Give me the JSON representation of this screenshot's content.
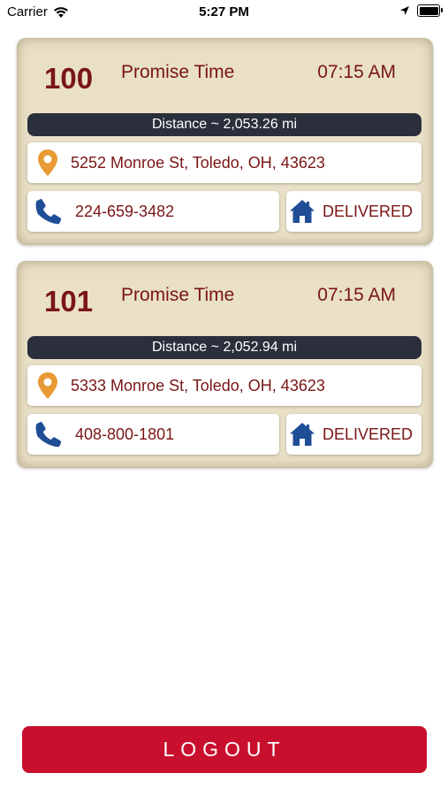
{
  "status_bar": {
    "carrier": "Carrier",
    "time": "5:27 PM",
    "icons": [
      "wifi-icon",
      "location-arrow-icon",
      "battery-icon"
    ]
  },
  "orders": [
    {
      "number": "100",
      "promise_label": "Promise Time",
      "promise_time": "07:15 AM",
      "distance": "Distance ~ 2,053.26 mi",
      "address": "5252 Monroe St, Toledo, OH, 43623",
      "phone": "224-659-3482",
      "status": "DELIVERED"
    },
    {
      "number": "101",
      "promise_label": "Promise Time",
      "promise_time": "07:15 AM",
      "distance": "Distance ~ 2,052.94 mi",
      "address": "5333 Monroe St, Toledo, OH, 43623",
      "phone": "408-800-1801",
      "status": "DELIVERED"
    }
  ],
  "logout": {
    "label": "LOGOUT"
  },
  "colors": {
    "card_bg": "#e9e0c7",
    "accent_text": "#7a1515",
    "distance_bar": "#2b2f3b",
    "pin": "#e89a35",
    "phone_home_icon": "#1f4e96",
    "logout_bg": "#c8102e"
  }
}
